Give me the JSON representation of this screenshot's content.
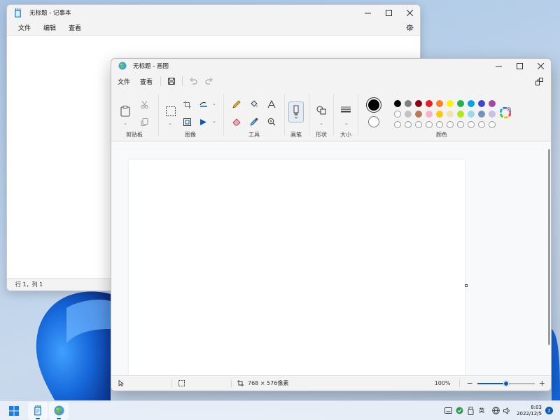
{
  "notepad": {
    "title": "无标题 - 记事本",
    "menus": [
      "文件",
      "编辑",
      "查看"
    ],
    "status": "行 1，列 1"
  },
  "paint": {
    "title": "无标题 - 画图",
    "menus": [
      "文件",
      "查看"
    ],
    "groups": {
      "clipboard": "剪贴板",
      "image": "图像",
      "tools": "工具",
      "brushes": "画笔",
      "shapes": "形状",
      "size": "大小",
      "colors": "颜色"
    },
    "colors": {
      "primary": "#000000",
      "secondary": "#ffffff",
      "row1": [
        "#000000",
        "#7f7f7f",
        "#880015",
        "#ed1c24",
        "#ff7f27",
        "#fff200",
        "#22b14c",
        "#00a2e8",
        "#3f48cc",
        "#a349a4"
      ],
      "row2": [
        "#ffffff",
        "#c3c3c3",
        "#b97a57",
        "#ffaec9",
        "#ffc90e",
        "#efe4b0",
        "#b5e61d",
        "#99d9ea",
        "#7092be",
        "#c8bfe7"
      ],
      "row3_empty_count": 10
    },
    "status": {
      "canvas_size": "768 × 576像素",
      "zoom": "100%",
      "zoom_level": 0.5
    }
  },
  "taskbar": {
    "ime": "英",
    "time": "8:03",
    "date": "2022/12/5",
    "notifications": "2"
  }
}
